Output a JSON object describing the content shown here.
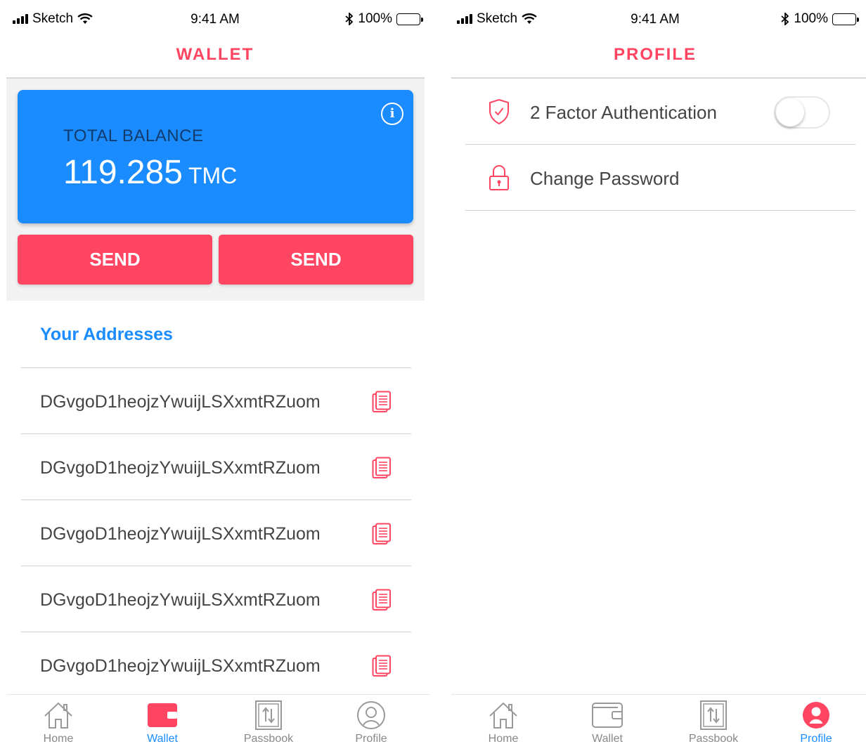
{
  "status_bar": {
    "carrier": "Sketch",
    "time": "9:41 AM",
    "battery": "100%"
  },
  "wallet": {
    "title": "WALLET",
    "balance_label": "TOTAL BALANCE",
    "balance_amount": "119.285",
    "balance_unit": "TMC",
    "send_button_1": "SEND",
    "send_button_2": "SEND",
    "addresses_heading": "Your Addresses",
    "addresses": [
      "DGvgoD1heojzYwuijLSXxmtRZuom",
      "DGvgoD1heojzYwuijLSXxmtRZuom",
      "DGvgoD1heojzYwuijLSXxmtRZuom",
      "DGvgoD1heojzYwuijLSXxmtRZuom",
      "DGvgoD1heojzYwuijLSXxmtRZuom"
    ]
  },
  "profile": {
    "title": "PROFILE",
    "two_factor_label": "2 Factor Authentication",
    "two_factor_enabled": false,
    "change_password_label": "Change Password"
  },
  "tabs": [
    "Home",
    "Wallet",
    "Passbook",
    "Profile"
  ],
  "icons": {
    "two_factor": "shield-check-icon",
    "change_password": "lock-icon",
    "copy": "copy-icon",
    "info": "info-icon",
    "tab_home": "home-icon",
    "tab_wallet": "wallet-icon",
    "tab_passbook": "passbook-icon",
    "tab_profile": "profile-icon"
  },
  "colors": {
    "accent_red": "#ff4561",
    "accent_blue": "#1a8cff",
    "card_label": "#123b6b",
    "inactive_tab": "#888888"
  }
}
